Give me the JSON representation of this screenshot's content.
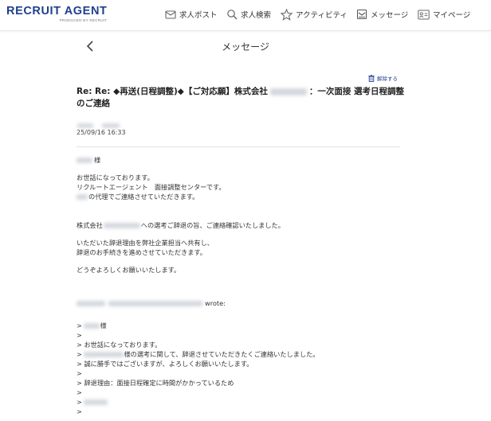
{
  "header": {
    "logo": "RECRUIT AGENT",
    "logo_sub": "PRODUCED BY RECRUIT",
    "nav": {
      "job_post": "求人ポスト",
      "job_search": "求人検索",
      "activity": "アクティビティ",
      "messages": "メッセージ",
      "mypage": "マイページ"
    }
  },
  "page": {
    "title": "メッセージ"
  },
  "message": {
    "unflag_label": "解除する",
    "subject_part1": "Re: Re: ◆再送(日程調整)◆【ご対応願】株式会社",
    "subject_part2": "：一次面接 選考日程調整",
    "subject_part3": "のご連絡",
    "date": "25/09/16 16:33",
    "body": {
      "salutation_suffix": "様",
      "greeting": "お世話になっております。",
      "team": "リクルートエージェント　面接調整センターです。",
      "proxy_suffix": "の代理でご連絡させていただきます。",
      "company_prefix": "株式会社",
      "confirm_suffix": "への選考ご辞退の旨、ご連絡確認いたしました。",
      "reason_line": "いただいた辞退理由を弊社企業担当へ共有し、",
      "procedure_line": "辞退のお手続きを進めさせていただきます。",
      "closing": "どうぞよろしくお願いいたします。",
      "wrote": "wrote:",
      "q_salutation_suffix": "様",
      "q_greeting": "お世話になっております。",
      "q_decline_suffix": "様の選考に関して、辞退させていただきたくご連絡いたしました。",
      "q_apology": "誠に勝手ではございますが、よろしくお願いいたします。",
      "q_reason": "辞退理由：面接日程確定に時間がかかっているため",
      "quote_mark": ">"
    }
  }
}
